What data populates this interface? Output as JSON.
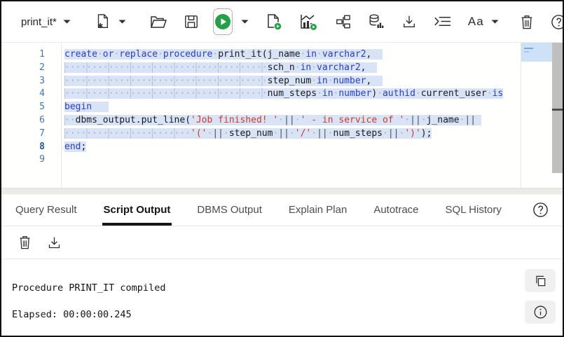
{
  "colors": {
    "accent_green": "#24a148",
    "keyword_blue": "#2a3cd0",
    "string_red": "#cf3a2b",
    "selection_blue": "#d8e3f6",
    "line_number_blue": "#3f76bb"
  },
  "toolbar": {
    "worksheet_name": "print_it*",
    "font_size_label": "Aa",
    "icons": [
      "worksheet-dropdown",
      "new-worksheet",
      "open-file",
      "save",
      "run-statement",
      "run-dropdown",
      "run-script",
      "autotrace",
      "explain-plan",
      "sql-tuning-advisor",
      "download",
      "format",
      "font-size",
      "clear-worksheet",
      "help"
    ]
  },
  "editor": {
    "line_numbers": [
      1,
      2,
      3,
      4,
      5,
      6,
      7,
      8,
      9
    ],
    "current_line": 8,
    "lines": [
      [
        [
          "kw",
          "create"
        ],
        [
          "ws",
          " "
        ],
        [
          "kw",
          "or"
        ],
        [
          "ws",
          " "
        ],
        [
          "kw",
          "replace"
        ],
        [
          "ws",
          " "
        ],
        [
          "kw",
          "procedure"
        ],
        [
          "ws",
          " "
        ],
        [
          "id",
          "print_it(j_name"
        ],
        [
          "ws",
          " "
        ],
        [
          "kw",
          "in"
        ],
        [
          "ws",
          " "
        ],
        [
          "kw",
          "varchar2"
        ],
        [
          "id",
          ","
        ],
        [
          "sp",
          "  "
        ]
      ],
      [
        [
          "lw",
          37
        ],
        [
          "id",
          "sch_n"
        ],
        [
          "ws",
          " "
        ],
        [
          "kw",
          "in"
        ],
        [
          "ws",
          " "
        ],
        [
          "kw",
          "varchar2"
        ],
        [
          "id",
          ","
        ],
        [
          "sp",
          "  "
        ]
      ],
      [
        [
          "lw",
          37
        ],
        [
          "id",
          "step_num"
        ],
        [
          "ws",
          " "
        ],
        [
          "kw",
          "in"
        ],
        [
          "ws",
          " "
        ],
        [
          "kw",
          "number"
        ],
        [
          "id",
          ","
        ],
        [
          "sp",
          "  "
        ]
      ],
      [
        [
          "lw",
          37
        ],
        [
          "id",
          "num_steps"
        ],
        [
          "ws",
          " "
        ],
        [
          "kw",
          "in"
        ],
        [
          "ws",
          " "
        ],
        [
          "kw",
          "number"
        ],
        [
          "id",
          ")"
        ],
        [
          "ws",
          " "
        ],
        [
          "kw",
          "authid"
        ],
        [
          "ws",
          " "
        ],
        [
          "id",
          "current_user"
        ],
        [
          "ws",
          " "
        ],
        [
          "kw",
          "is"
        ]
      ],
      [
        [
          "kw",
          "begin"
        ],
        [
          "sp",
          "   "
        ]
      ],
      [
        [
          "lw",
          2
        ],
        [
          "id",
          "dbms_output.put_line("
        ],
        [
          "str",
          "'Job finished! '"
        ],
        [
          "ws",
          " "
        ],
        [
          "op",
          "||"
        ],
        [
          "ws",
          " "
        ],
        [
          "str",
          "' - in service of '"
        ],
        [
          "ws",
          " "
        ],
        [
          "op",
          "||"
        ],
        [
          "ws",
          " "
        ],
        [
          "id",
          "j_name"
        ],
        [
          "ws",
          " "
        ],
        [
          "op",
          "||"
        ],
        [
          "sp",
          " "
        ]
      ],
      [
        [
          "lw",
          23
        ],
        [
          "str",
          "'('"
        ],
        [
          "ws",
          " "
        ],
        [
          "op",
          "||"
        ],
        [
          "ws",
          " "
        ],
        [
          "id",
          "step_num"
        ],
        [
          "ws",
          " "
        ],
        [
          "op",
          "||"
        ],
        [
          "ws",
          " "
        ],
        [
          "str",
          "'/'"
        ],
        [
          "ws",
          " "
        ],
        [
          "op",
          "||"
        ],
        [
          "ws",
          " "
        ],
        [
          "id",
          "num_steps"
        ],
        [
          "ws",
          " "
        ],
        [
          "op",
          "||"
        ],
        [
          "ws",
          " "
        ],
        [
          "str",
          "')'"
        ],
        [
          "id",
          ");"
        ]
      ],
      [
        [
          "kw",
          "end"
        ],
        [
          "id",
          ";"
        ]
      ],
      []
    ]
  },
  "tabs": {
    "items": [
      {
        "label": "Query Result",
        "active": false
      },
      {
        "label": "Script Output",
        "active": true
      },
      {
        "label": "DBMS Output",
        "active": false
      },
      {
        "label": "Explain Plan",
        "active": false
      },
      {
        "label": "Autotrace",
        "active": false
      },
      {
        "label": "SQL History",
        "active": false
      }
    ],
    "help_icon": "help-icon"
  },
  "output_toolbar": {
    "icons": [
      "clear-output",
      "download-output"
    ]
  },
  "output": {
    "lines": [
      "Procedure PRINT_IT compiled",
      "Elapsed: 00:00:00.245"
    ],
    "buttons": [
      "copy",
      "info"
    ]
  }
}
